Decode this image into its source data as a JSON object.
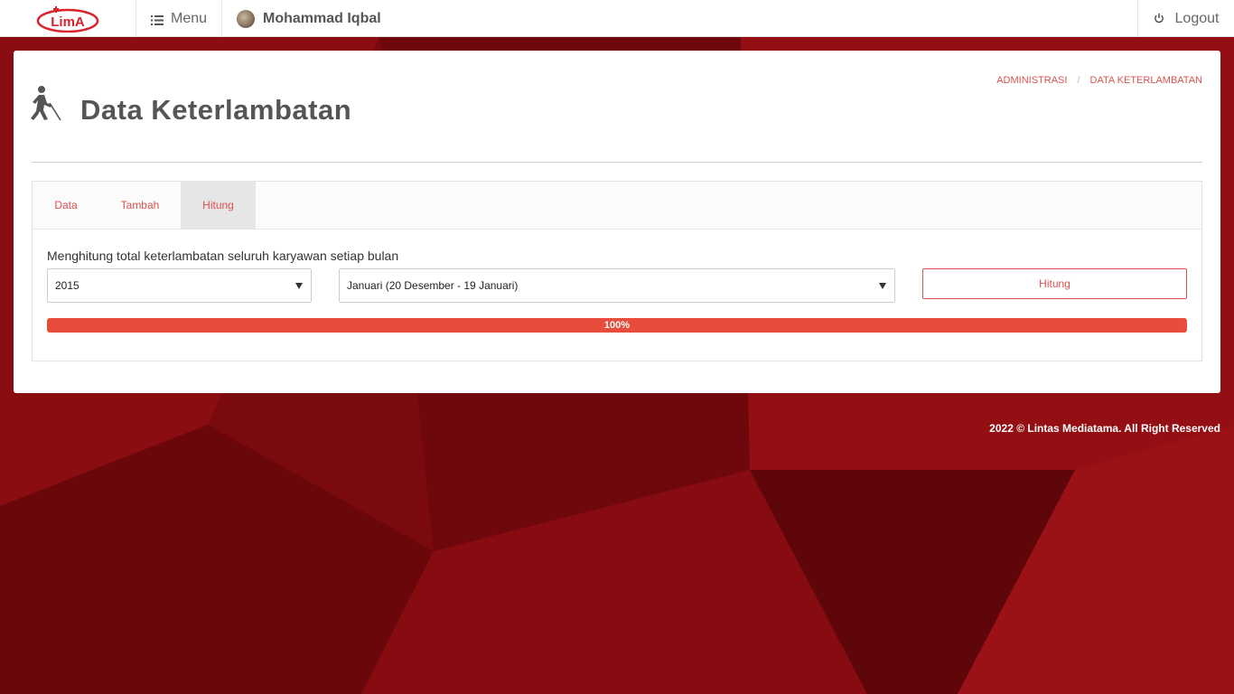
{
  "brand": {
    "logo_text": "LimA",
    "logo_color": "#d9232d"
  },
  "nav": {
    "menu_label": "Menu",
    "menu_icon": "hamburger-icon",
    "user_name": "Mohammad Iqbal",
    "logout_label": "Logout",
    "logout_icon": "power-icon"
  },
  "page": {
    "title": "Data Keterlambatan",
    "icon": "walking-person-icon",
    "breadcrumb": [
      "ADMINISTRASI",
      "DATA KETERLAMBATAN"
    ]
  },
  "tabs": [
    {
      "label": "Data",
      "active": false
    },
    {
      "label": "Tambah",
      "active": false
    },
    {
      "label": "Hitung",
      "active": true
    }
  ],
  "form": {
    "description": "Menghitung total keterlambatan seluruh karyawan setiap bulan",
    "year_value": "2015",
    "month_value": "Januari (20 Desember - 19 Januari)",
    "button_label": "Hitung"
  },
  "progress": {
    "label": "100%",
    "value": 1.0,
    "color": "#e74c3c"
  },
  "footer": {
    "text": "2022 © Lintas Mediatama. All Right Reserved"
  },
  "colors": {
    "accent": "#d9534f",
    "background": "#7a0a0e"
  }
}
